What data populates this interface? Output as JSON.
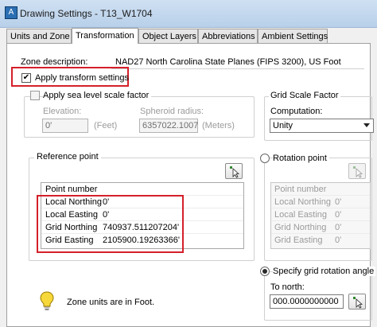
{
  "window": {
    "title": "Drawing Settings - T13_W1704",
    "app_icon": "A"
  },
  "tabs": [
    {
      "label": "Units and Zone",
      "active": false
    },
    {
      "label": "Transformation",
      "active": true
    },
    {
      "label": "Object Layers",
      "active": false
    },
    {
      "label": "Abbreviations",
      "active": false
    },
    {
      "label": "Ambient Settings",
      "active": false
    }
  ],
  "zone": {
    "label": "Zone description:",
    "value": "NAD27 North Carolina State Planes (FIPS 3200), US Foot"
  },
  "apply_transform": {
    "label": "Apply transform settings",
    "checked": "✔"
  },
  "sea_level": {
    "label": "Apply sea level scale factor",
    "elevation_label": "Elevation:",
    "elevation_value": "0'",
    "elevation_unit": "(Feet)",
    "spheroid_label": "Spheroid radius:",
    "spheroid_value": "6357022.1007",
    "spheroid_unit": "(Meters)"
  },
  "grid_scale": {
    "title": "Grid Scale Factor",
    "computation_label": "Computation:",
    "computation_value": "Unity"
  },
  "reference_point": {
    "title": "Reference point",
    "header": "Point number",
    "rows": [
      {
        "name": "Local Northing",
        "value": "0'"
      },
      {
        "name": "Local Easting",
        "value": "0'"
      },
      {
        "name": "Grid Northing",
        "value": "740937.511207204'"
      },
      {
        "name": "Grid Easting",
        "value": "2105900.19263366'"
      }
    ]
  },
  "rotation_point": {
    "label": "Rotation point",
    "header": "Point number",
    "rows": [
      {
        "name": "Local Northing",
        "value": "0'"
      },
      {
        "name": "Local Easting",
        "value": "0'"
      },
      {
        "name": "Grid Northing",
        "value": "0'"
      },
      {
        "name": "Grid Easting",
        "value": "0'"
      }
    ]
  },
  "grid_rotation": {
    "label": "Specify grid rotation angle",
    "to_north_label": "To north:",
    "to_north_value": "000.0000000000"
  },
  "info": {
    "message": "Zone units are in Foot."
  },
  "colors": {
    "highlight": "#d5202a",
    "title_bar": "#c4d8ee"
  }
}
